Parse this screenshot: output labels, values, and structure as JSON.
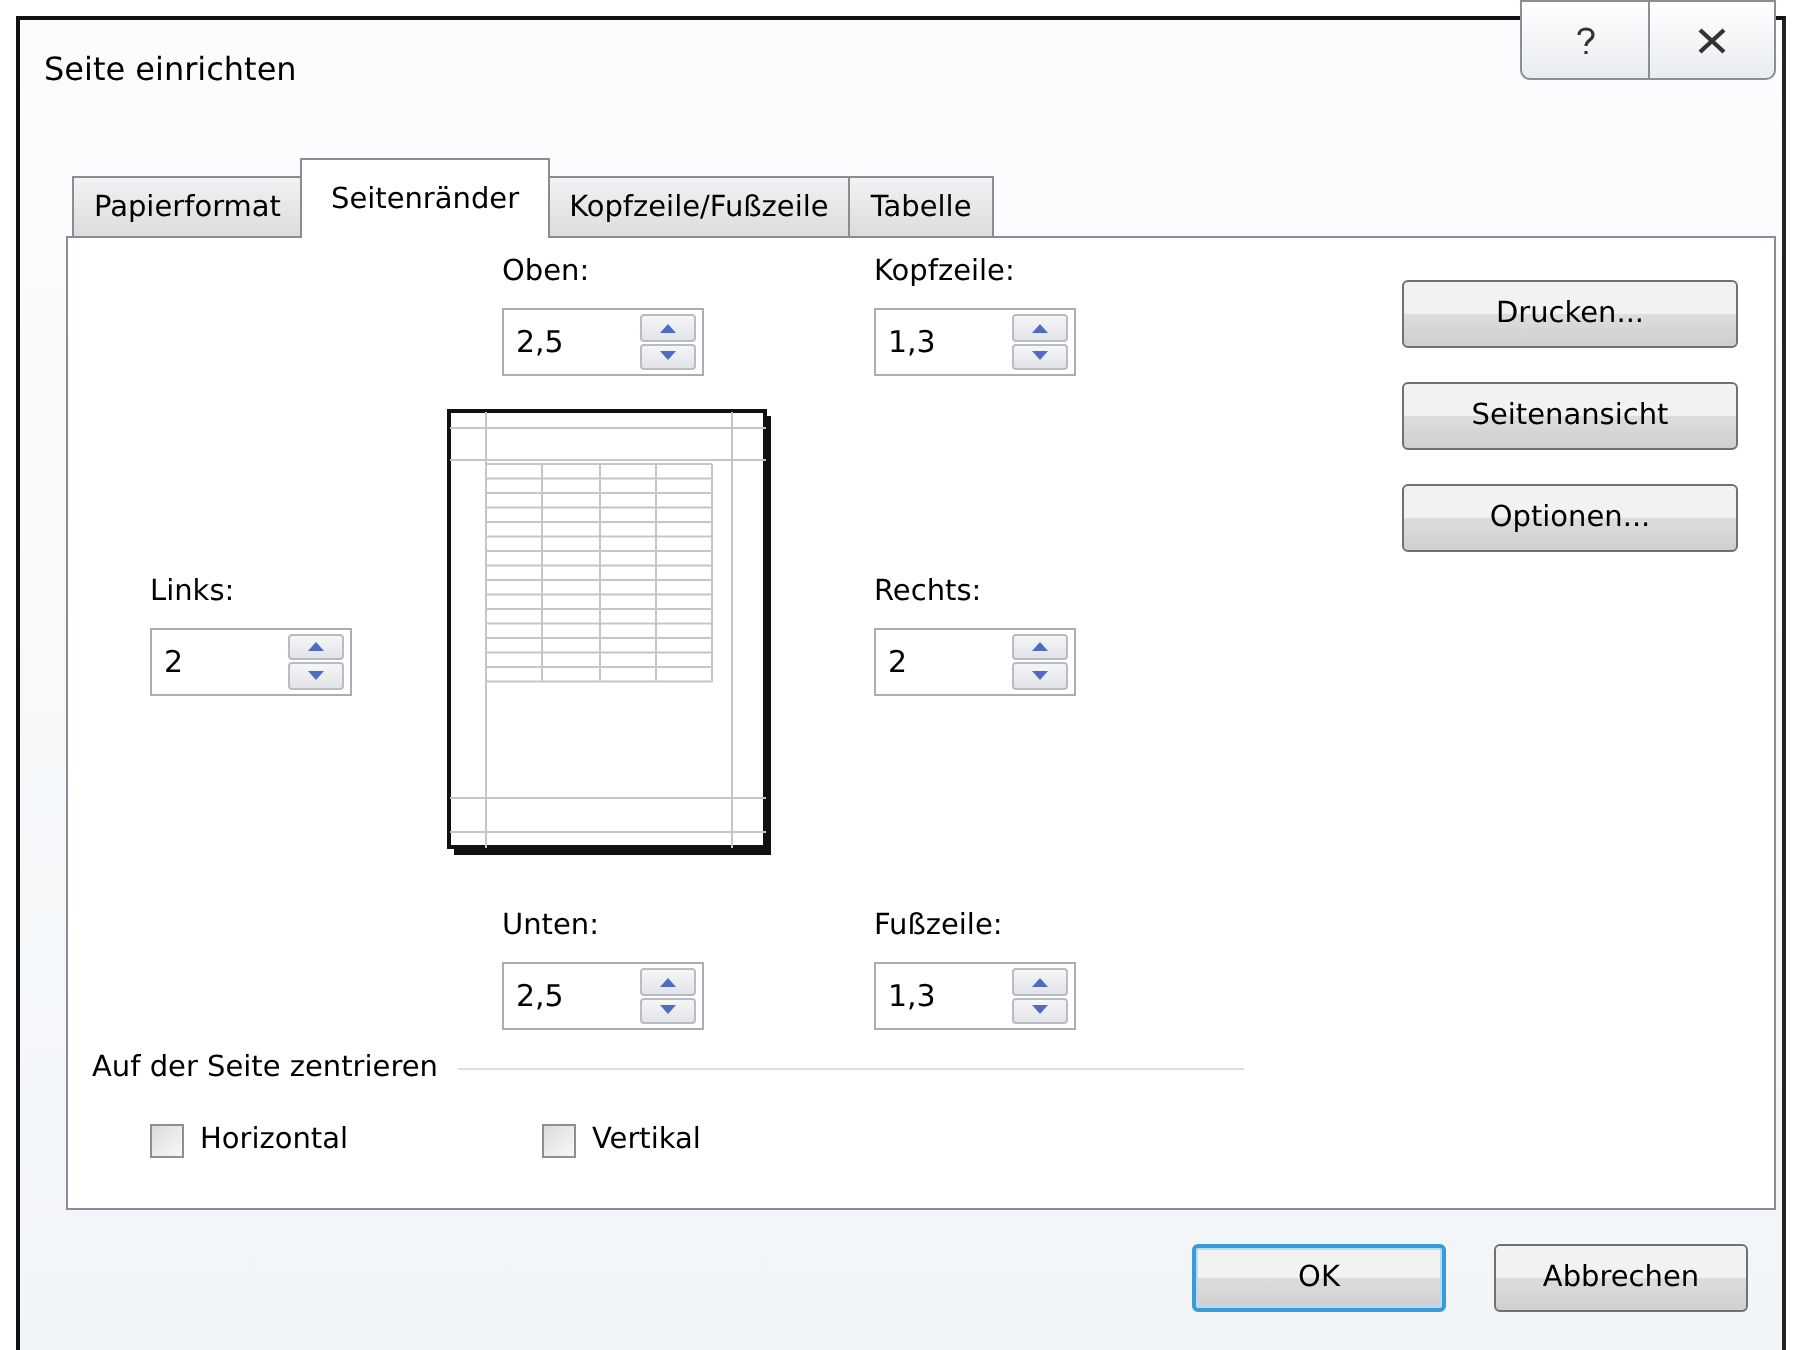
{
  "window": {
    "title": "Seite einrichten"
  },
  "title_buttons": [
    {
      "kind": "help"
    },
    {
      "kind": "close"
    }
  ],
  "tabs": [
    {
      "label": "Papierformat",
      "selected": false
    },
    {
      "label": "Seitenränder",
      "selected": true
    },
    {
      "label": "Kopfzeile/Fußzeile",
      "selected": false
    },
    {
      "label": "Tabelle",
      "selected": false
    }
  ],
  "margins": {
    "top": {
      "label": "Oben:",
      "value": "2,5"
    },
    "header": {
      "label": "Kopfzeile:",
      "value": "1,3"
    },
    "left": {
      "label": "Links:",
      "value": "2"
    },
    "right": {
      "label": "Rechts:",
      "value": "2"
    },
    "bottom": {
      "label": "Unten:",
      "value": "2,5"
    },
    "footer": {
      "label": "Fußzeile:",
      "value": "1,3"
    }
  },
  "side_buttons": [
    "Drucken...",
    "Seitenansicht",
    "Optionen..."
  ],
  "center_on_page": {
    "title": "Auf der Seite zentrieren",
    "options": [
      {
        "label": "Horizontal",
        "checked": false
      },
      {
        "label": "Vertikal",
        "checked": false
      }
    ]
  },
  "buttons": [
    {
      "label": "OK",
      "default": true
    },
    {
      "label": "Abbrechen",
      "default": false
    }
  ]
}
